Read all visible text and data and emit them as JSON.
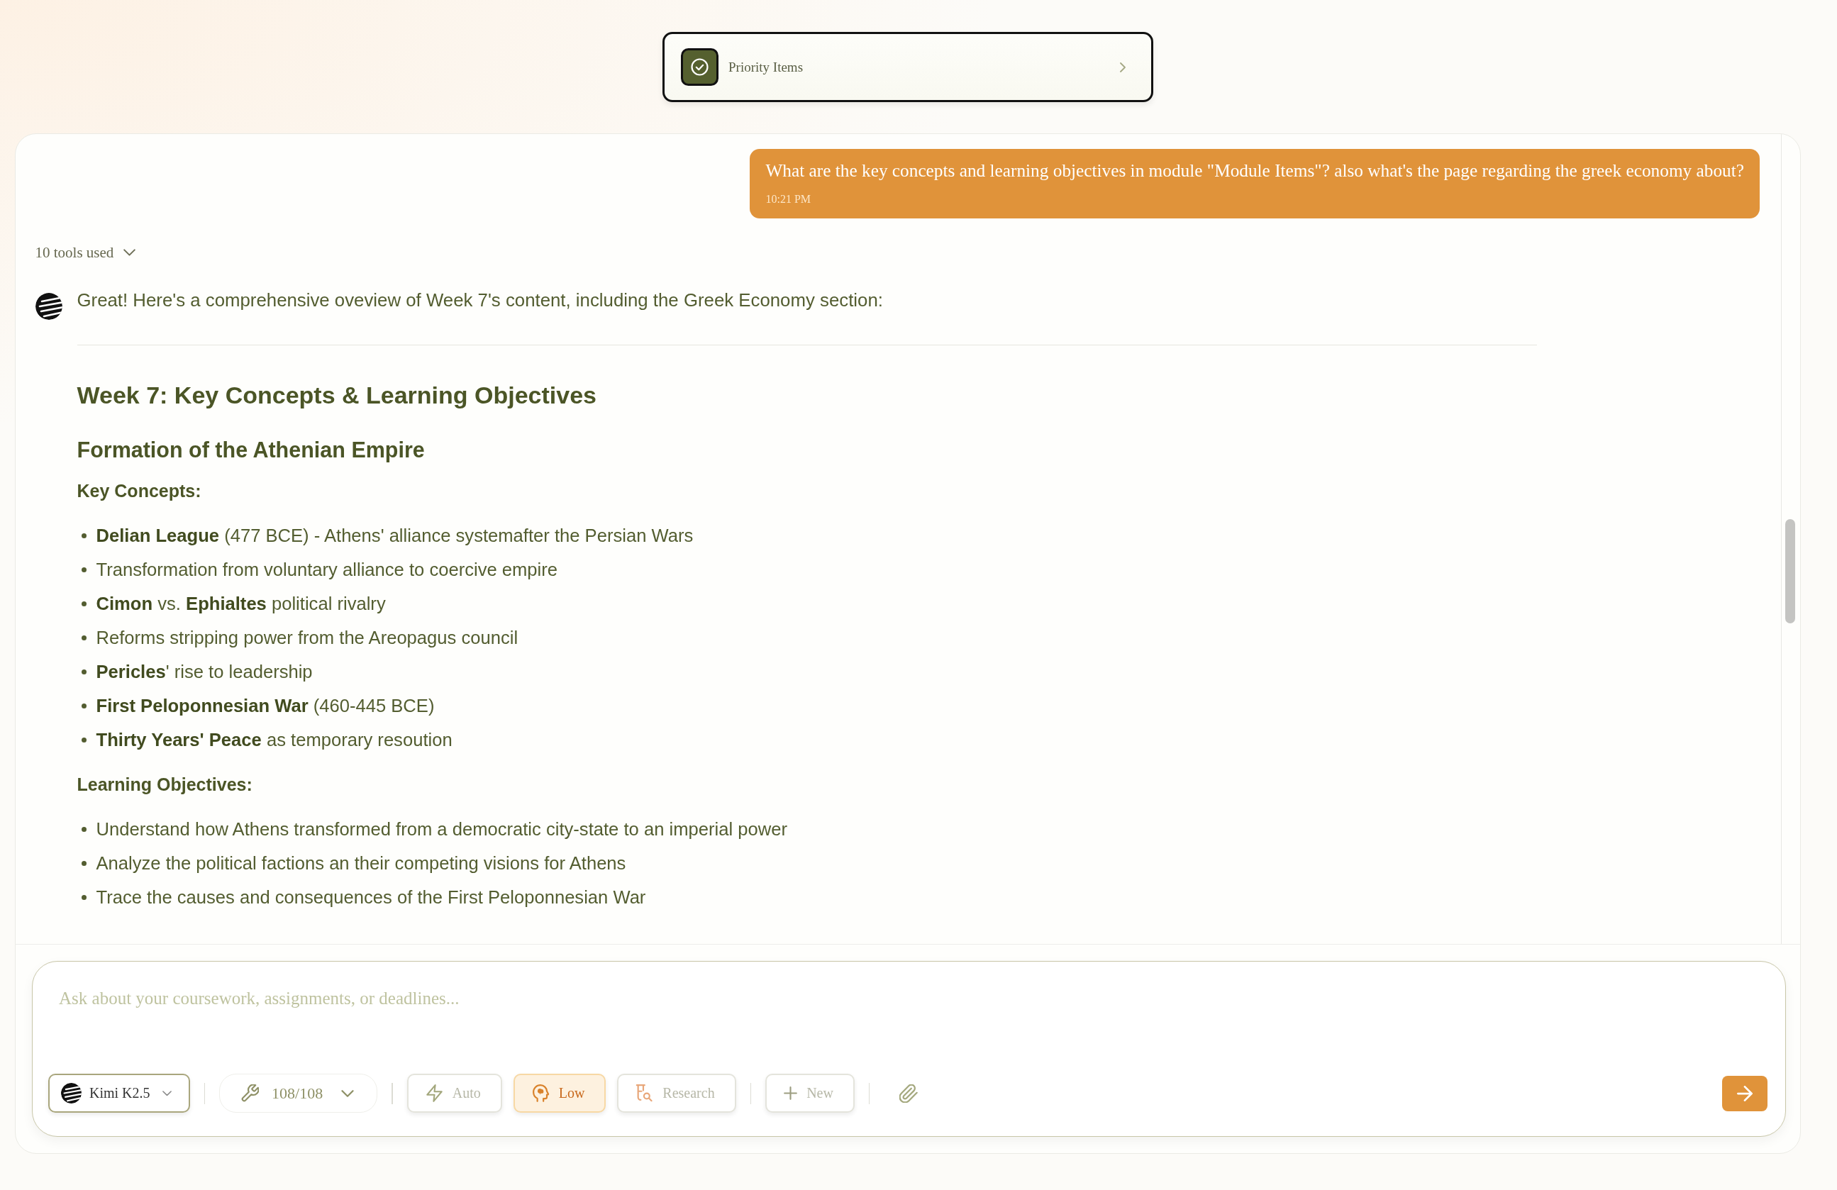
{
  "priority_bar": {
    "label": "Priority Items"
  },
  "conversation": {
    "user_message": {
      "text": "What are the key concepts and learning objectives in module \"Module Items\"? also what's the page regarding the greek economy about?",
      "time": "10:21 PM"
    },
    "tools_toggle": {
      "label": "10 tools used",
      "expanded": false
    },
    "assistant_message": {
      "intro": "Great! Here's a comprehensive oveview of Week 7's content, including the Greek Economy section:",
      "blocks": [
        {
          "kind": "title",
          "text": "Week 7: Key Concepts & Learning Objectives"
        },
        {
          "kind": "subtitle",
          "text": "Formation of the Athenian Empire"
        },
        {
          "kind": "label",
          "text": "Key Concepts:"
        },
        {
          "kind": "list",
          "items": [
            "**Delian League** (477 BCE) - Athens' alliance systemafter the Persian Wars",
            "Transformation from voluntary alliance to coercive empire",
            "**Cimon** vs. **Ephialtes** political rivalry",
            "Reforms stripping power from the Areopagus council",
            "**Pericles**' rise to leadership",
            "**First Peloponnesian War** (460-445 BCE)",
            "**Thirty Years' Peace** as temporary resoution"
          ]
        },
        {
          "kind": "label",
          "text": "Learning Objectives:"
        },
        {
          "kind": "list",
          "items": [
            "Understand how Athens transformed from a democratic city-state to an imperial power",
            "Analyze the political factions an their competing visions for Athens",
            "Trace the causes and consequences of the First Peloponnesian War"
          ]
        }
      ]
    }
  },
  "composer": {
    "placeholder": "Ask about your coursework, assignments, or deadlines...",
    "model": {
      "label": "Kimi K2.5"
    },
    "tools": {
      "label": "108/108"
    },
    "modes": [
      {
        "label": "Auto",
        "selected": false
      },
      {
        "label": "Low",
        "selected": true
      },
      {
        "label": "Research",
        "selected": false
      }
    ],
    "new_chat": {
      "label": "New"
    }
  }
}
